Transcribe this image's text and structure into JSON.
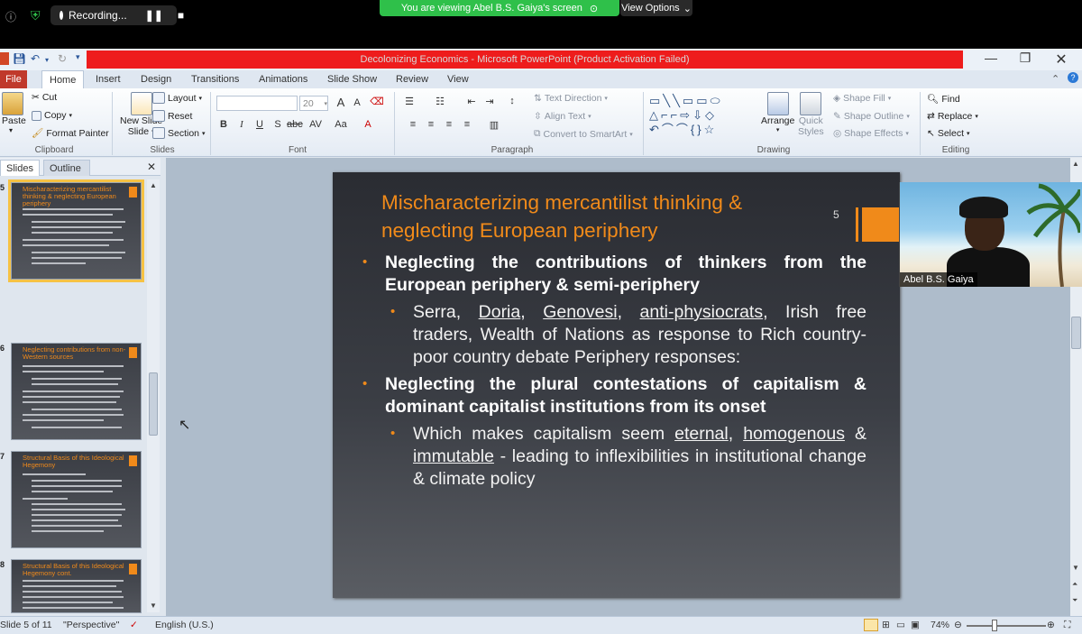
{
  "zoom": {
    "recording_label": "Recording...",
    "viewing_text": "You are viewing Abel B.S. Gaiya's screen",
    "view_options_label": "View Options",
    "participant_name": "Abel B.S. Gaiya"
  },
  "window": {
    "title": "Decolonizing Economics - Microsoft PowerPoint (Product Activation Failed)"
  },
  "tabs": [
    "File",
    "Home",
    "Insert",
    "Design",
    "Transitions",
    "Animations",
    "Slide Show",
    "Review",
    "View"
  ],
  "ribbon": {
    "clipboard": {
      "paste": "Paste",
      "cut": "Cut",
      "copy": "Copy",
      "format_painter": "Format Painter",
      "label": "Clipboard"
    },
    "slides": {
      "new_slide": "New Slide",
      "new_slide2": "Slide",
      "layout": "Layout",
      "reset": "Reset",
      "section": "Section",
      "label": "Slides"
    },
    "font": {
      "size": "20",
      "label": "Font"
    },
    "paragraph": {
      "text_direction": "Text Direction",
      "align_text": "Align Text",
      "convert": "Convert to SmartArt",
      "label": "Paragraph"
    },
    "drawing": {
      "arrange": "Arrange",
      "quick_styles": "Quick",
      "quick_styles2": "Styles",
      "shape_fill": "Shape Fill",
      "shape_outline": "Shape Outline",
      "shape_effects": "Shape Effects",
      "label": "Drawing"
    },
    "editing": {
      "find": "Find",
      "replace": "Replace",
      "select": "Select",
      "label": "Editing"
    }
  },
  "panel": {
    "tab_slides": "Slides",
    "tab_outline": "Outline",
    "thumbs": [
      {
        "num": "5",
        "title": "Mischaracterizing mercantilist thinking & neglecting European periphery"
      },
      {
        "num": "6",
        "title": "Neglecting contributions from non-Western sources"
      },
      {
        "num": "7",
        "title": "Structural Basis of this Ideological Hegemony"
      },
      {
        "num": "8",
        "title": "Structural Basis of this Ideological Hegemony cont."
      }
    ]
  },
  "slide": {
    "number": "5",
    "title": "Mischaracterizing mercantilist thinking & neglecting European periphery",
    "bullet1": "Neglecting the contributions of thinkers from the European periphery & semi-periphery",
    "sub1_names": [
      "Serra",
      "Doria",
      "Genovesi",
      "anti-physiocrats"
    ],
    "sub1_sep": ", ",
    "sub1_rest": ", Irish free traders, Wealth of Nations as response to Rich country-poor country debate Periphery responses:",
    "bullet2": "Neglecting the plural contestations of capitalism & dominant capitalist institutions from its onset",
    "sub2_pre": "Which makes capitalism seem ",
    "sub2_w1": "eternal",
    "sub2_w2": "homogenous",
    "sub2_mid1": ", ",
    "sub2_mid2": " & ",
    "sub2_w3": "immutable",
    "sub2_post": " - leading to inflexibilities in institutional change & climate policy"
  },
  "status": {
    "slide_of": "Slide 5 of 11",
    "theme": "\"Perspective\"",
    "language": "English (U.S.)",
    "zoom": "74%"
  },
  "colors": {
    "accent": "#f08a1a",
    "title_bar": "#ee1c1c",
    "zoom_green": "#2fc04a"
  }
}
